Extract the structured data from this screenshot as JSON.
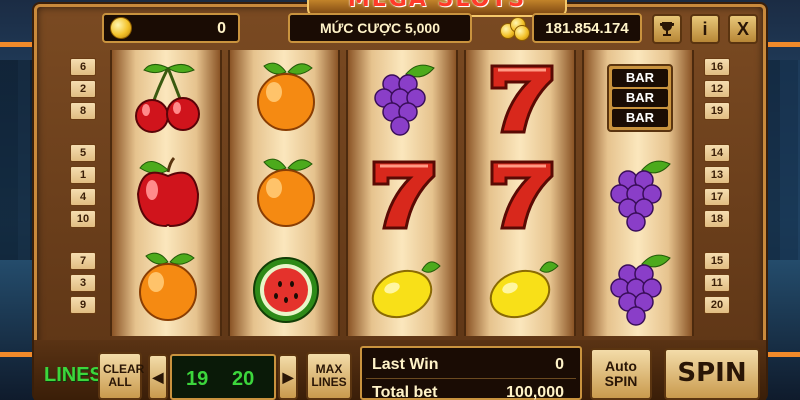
{
  "game": {
    "title": "MEGA SLOTS",
    "balance_left": "0",
    "bet_label": "MỨC CƯỢC 5,000",
    "total_coins": "181.854.174"
  },
  "top_buttons": {
    "trophy": "trophy-icon",
    "info": "i",
    "close": "X"
  },
  "line_numbers": {
    "left": [
      "6",
      "2",
      "8",
      "5",
      "1",
      "4",
      "10",
      "7",
      "3",
      "9"
    ],
    "right": [
      "16",
      "12",
      "19",
      "14",
      "13",
      "17",
      "18",
      "15",
      "11",
      "20"
    ]
  },
  "reels": [
    [
      "cherry",
      "apple",
      "orange"
    ],
    [
      "orange",
      "orange",
      "watermelon"
    ],
    [
      "grapes",
      "seven",
      "lemon"
    ],
    [
      "seven",
      "seven",
      "lemon"
    ],
    [
      "bar",
      "grapes",
      "grapes"
    ]
  ],
  "bar_symbol_text": [
    "BAR",
    "BAR",
    "BAR"
  ],
  "controls": {
    "lines_label": "LINES",
    "clear_all": "CLEAR ALL",
    "line_selected": "19",
    "line_count": "20",
    "max_lines": "MAX LINES",
    "last_win_label": "Last Win",
    "last_win_value": "0",
    "total_bet_label": "Total bet",
    "total_bet_value": "100,000",
    "auto_spin": "Auto SPIN",
    "spin": "SPIN"
  },
  "colors": {
    "frame_gold": "#c9933e",
    "lines_green": "#3cd63c",
    "title_red": "#ff3b2a"
  }
}
